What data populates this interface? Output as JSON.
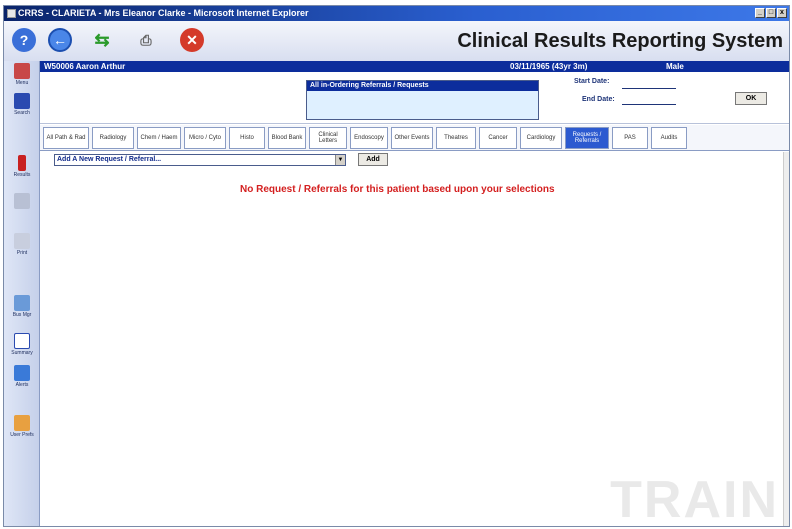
{
  "window": {
    "title": "CRRS - CLARIETA - Mrs Eleanor Clarke - Microsoft Internet Explorer",
    "title_short": "CRRS - CLARIETA - Mrs Eleanor Clarke - Microsoft Internet Explorer",
    "controls": [
      "_",
      "□",
      "x"
    ]
  },
  "toolbar": {
    "app_title": "Clinical Results Reporting System",
    "icons": [
      "help-icon",
      "back-icon",
      "refresh-icon",
      "print-icon",
      "close-icon"
    ]
  },
  "patient": {
    "id_name": "W50006  Aaron Arthur",
    "dob": "03/11/1965 (43yr 3m)",
    "sex": "Male"
  },
  "header": {
    "alert_title": "All in-Ordering Referrals / Requests",
    "start_date_label": "Start Date:",
    "end_date_label": "End Date:",
    "ok_label": "OK"
  },
  "sidebar": {
    "items": [
      {
        "label": "Menu",
        "icon": "menu-icon"
      },
      {
        "label": "Search",
        "icon": "binoculars-icon"
      },
      {
        "label": "Results",
        "icon": "results-icon"
      },
      {
        "label": "",
        "icon": "document-icon"
      },
      {
        "label": "Print",
        "icon": "print-icon"
      },
      {
        "label": "Bus Mgr",
        "icon": "bus-icon"
      },
      {
        "label": "Summary",
        "icon": "summary-icon"
      },
      {
        "label": "Alerts",
        "icon": "alerts-icon"
      },
      {
        "label": "User Prefs",
        "icon": "user-icon"
      }
    ]
  },
  "tabs": [
    {
      "label": "All Path & Rad"
    },
    {
      "label": "Radiology"
    },
    {
      "label": "Chem / Haem"
    },
    {
      "label": "Micro / Cyto"
    },
    {
      "label": "Histo"
    },
    {
      "label": "Blood Bank"
    },
    {
      "label": "Clinical Letters"
    },
    {
      "label": "Endoscopy"
    },
    {
      "label": "Other Events"
    },
    {
      "label": "Theatres"
    },
    {
      "label": "Cancer"
    },
    {
      "label": "Cardiology"
    },
    {
      "label": "Requests / Referrals",
      "active": true
    },
    {
      "label": "PAS"
    },
    {
      "label": "Audits"
    }
  ],
  "content": {
    "select_value": "Add A New Request / Referral...",
    "add_label": "Add",
    "message": "No Request / Referrals for this patient based upon your selections",
    "watermark": "TRAIN"
  },
  "colors": {
    "title_bar": "#0a246a",
    "patient_bar": "#0c2d9c",
    "active_tab": "#2c5ad0",
    "message": "#d42020"
  }
}
